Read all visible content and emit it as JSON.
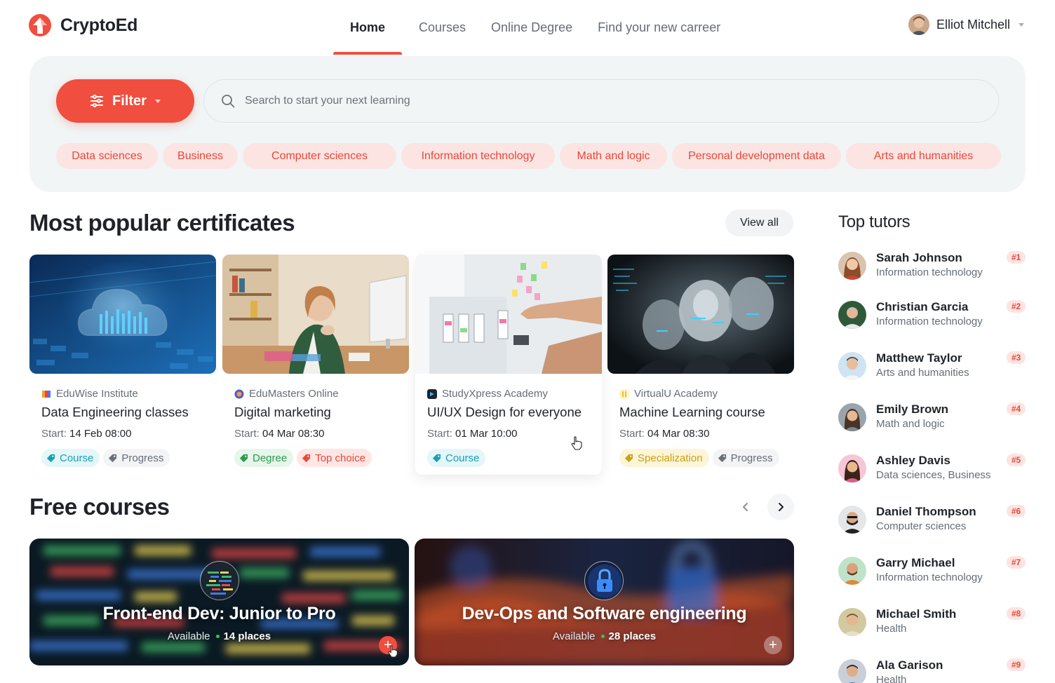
{
  "brand": {
    "name": "CryptoEd",
    "accent": "#f04e3e"
  },
  "nav": {
    "items": [
      {
        "label": "Home",
        "active": true
      },
      {
        "label": "Courses"
      },
      {
        "label": "Online Degree"
      },
      {
        "label": "Find your new carreer"
      }
    ]
  },
  "user": {
    "name": "Elliot Mitchell",
    "icon": "chevron-down-icon"
  },
  "search": {
    "filter_label": "Filter",
    "placeholder": "Search to start your next learning",
    "value": ""
  },
  "categories": [
    "Data sciences",
    "Business",
    "Computer sciences",
    "Information technology",
    "Math and logic",
    "Personal development data",
    "Arts and humanities"
  ],
  "popular": {
    "title": "Most popular certificates",
    "view_all": "View all",
    "start_label": "Start:",
    "cards": [
      {
        "institution": "EduWise Institute",
        "title": "Data Engineering classes",
        "start": "14 Feb 08:00",
        "tags": [
          "Course",
          "Progress"
        ]
      },
      {
        "institution": "EduMasters Online",
        "title": "Digital marketing",
        "start": "04 Mar 08:30",
        "tags": [
          "Degree",
          "Top choice"
        ]
      },
      {
        "institution": "StudyXpress Academy",
        "title": "UI/UX Design for everyone",
        "start": "01 Mar 10:00",
        "tags": [
          "Course"
        ]
      },
      {
        "institution": "VirtualU Academy",
        "title": "Machine Learning course",
        "start": "04 Mar 08:30",
        "tags": [
          "Specialization",
          "Progress"
        ]
      }
    ]
  },
  "free": {
    "title": "Free courses",
    "available_label": "Available",
    "courses": [
      {
        "title": "Front-end Dev: Junior to Pro",
        "places": "14 places"
      },
      {
        "title": "Dev-Ops and Software engineering",
        "places": "28 places"
      }
    ]
  },
  "tutors": {
    "title": "Top tutors",
    "items": [
      {
        "name": "Sarah Johnson",
        "field": "Information technology",
        "rank": "#1"
      },
      {
        "name": "Christian Garcia",
        "field": "Information technology",
        "rank": "#2"
      },
      {
        "name": "Matthew Taylor",
        "field": "Arts and humanities",
        "rank": "#3"
      },
      {
        "name": "Emily Brown",
        "field": "Math and logic",
        "rank": "#4"
      },
      {
        "name": "Ashley Davis",
        "field": "Data sciences, Business",
        "rank": "#5"
      },
      {
        "name": "Daniel Thompson",
        "field": "Computer sciences",
        "rank": "#6"
      },
      {
        "name": "Garry Michael",
        "field": "Information technology",
        "rank": "#7"
      },
      {
        "name": "Michael Smith",
        "field": "Health",
        "rank": "#8"
      },
      {
        "name": "Ala Garison",
        "field": "Health",
        "rank": "#9"
      }
    ]
  }
}
